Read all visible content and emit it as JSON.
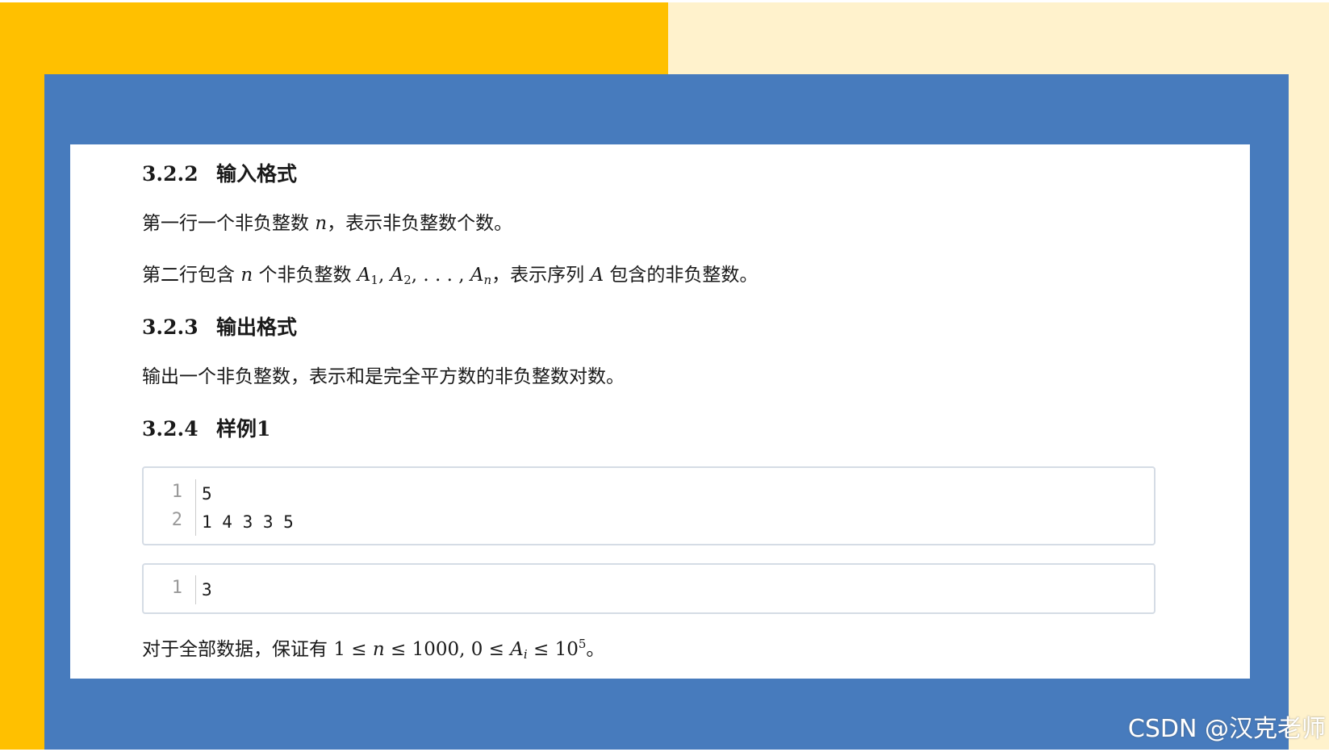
{
  "colors": {
    "left_bg": "#ffc000",
    "right_bg": "#fff2cc",
    "frame": "#477bbd",
    "sheet": "#ffffff"
  },
  "sections": {
    "input": {
      "number": "3.2.2",
      "title": "输入格式"
    },
    "output": {
      "number": "3.2.3",
      "title": "输出格式"
    },
    "sample": {
      "number": "3.2.4",
      "title": "样例1"
    }
  },
  "paragraphs": {
    "line1_a": "第一行一个非负整数 ",
    "line1_var": "n",
    "line1_b": "，表示非负整数个数。",
    "line2_a": "第二行包含 ",
    "line2_var": "n",
    "line2_b": " 个非负整数 ",
    "line2_seq": "A",
    "line2_sub1": "1",
    "line2_comma1": ", ",
    "line2_seq2": "A",
    "line2_sub2": "2",
    "line2_dots": ", . . . , ",
    "line2_seq3": "A",
    "line2_subn": "n",
    "line2_c": "，表示序列 ",
    "line2_var2": "A",
    "line2_d": " 包含的非负整数。",
    "output_text": "输出一个非负整数，表示和是完全平方数的非负整数对数。",
    "constraint_a": "对于全部数据，保证有 ",
    "constraint_math_1": "1 ≤ ",
    "constraint_var_n": "n",
    "constraint_math_2": " ≤ 1000, 0 ≤ ",
    "constraint_var_a": "A",
    "constraint_sub_i": "i",
    "constraint_math_3": " ≤ 10",
    "constraint_sup": "5",
    "constraint_end": "。"
  },
  "sample_input": {
    "lines": [
      {
        "no": "1",
        "text": "5"
      },
      {
        "no": "2",
        "text": "1 4 3 3 5"
      }
    ]
  },
  "sample_output": {
    "lines": [
      {
        "no": "1",
        "text": "3"
      }
    ]
  },
  "watermark": "CSDN @汉克老师"
}
